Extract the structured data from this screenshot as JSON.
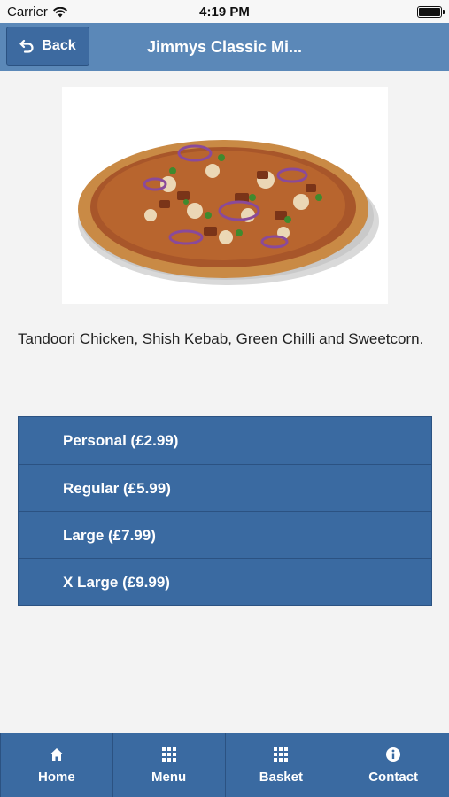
{
  "status_bar": {
    "carrier": "Carrier",
    "time": "4:19 PM"
  },
  "nav": {
    "back_label": "Back",
    "title": "Jimmys Classic Mi..."
  },
  "product": {
    "description": "Tandoori Chicken, Shish Kebab, Green Chilli and Sweetcorn."
  },
  "sizes": [
    {
      "label": "Personal (£2.99)"
    },
    {
      "label": "Regular (£5.99)"
    },
    {
      "label": "Large (£7.99)"
    },
    {
      "label": "X Large (£9.99)"
    }
  ],
  "tabs": [
    {
      "label": "Home",
      "icon": "home-icon"
    },
    {
      "label": "Menu",
      "icon": "grid-icon"
    },
    {
      "label": "Basket",
      "icon": "grid-icon"
    },
    {
      "label": "Contact",
      "icon": "info-icon"
    }
  ]
}
